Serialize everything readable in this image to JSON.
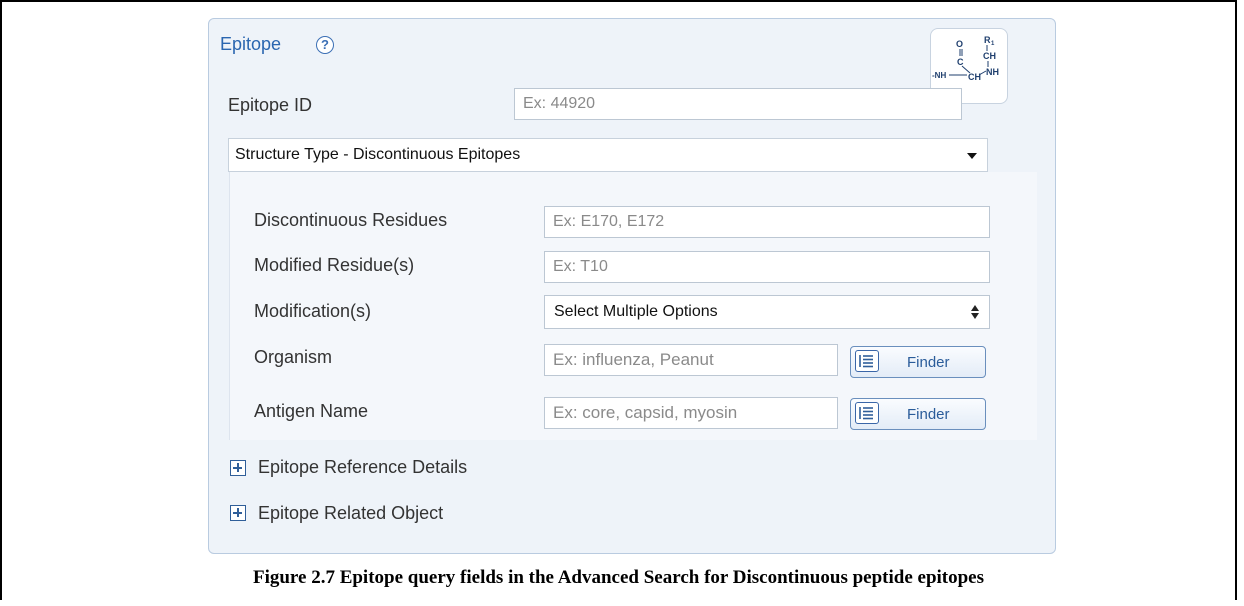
{
  "panel": {
    "title": "Epitope",
    "help_glyph": "?",
    "structure_icon": "peptide-structure-icon"
  },
  "fields": {
    "epitope_id": {
      "label": "Epitope ID",
      "placeholder": "Ex: 44920"
    },
    "structure_type": {
      "selected": "Structure Type - Discontinuous Epitopes"
    },
    "discontinuous_residues": {
      "label": "Discontinuous Residues",
      "placeholder": "Ex: E170, E172"
    },
    "modified_residues": {
      "label": "Modified Residue(s)",
      "placeholder": "Ex: T10"
    },
    "modifications": {
      "label": "Modification(s)",
      "selected": "Select Multiple Options"
    },
    "organism": {
      "label": "Organism",
      "placeholder": "Ex: influenza, Peanut",
      "button": "Finder"
    },
    "antigen_name": {
      "label": "Antigen Name",
      "placeholder": "Ex: core, capsid, myosin",
      "button": "Finder"
    }
  },
  "expanders": [
    {
      "label": "Epitope Reference Details"
    },
    {
      "label": "Epitope Related Object"
    }
  ],
  "caption": "Figure 2.7  Epitope query fields in the Advanced Search for Discontinuous peptide epitopes",
  "colors": {
    "accent": "#2a66b0",
    "panel_bg": "#eef3f9",
    "border": "#b9cbe0"
  }
}
